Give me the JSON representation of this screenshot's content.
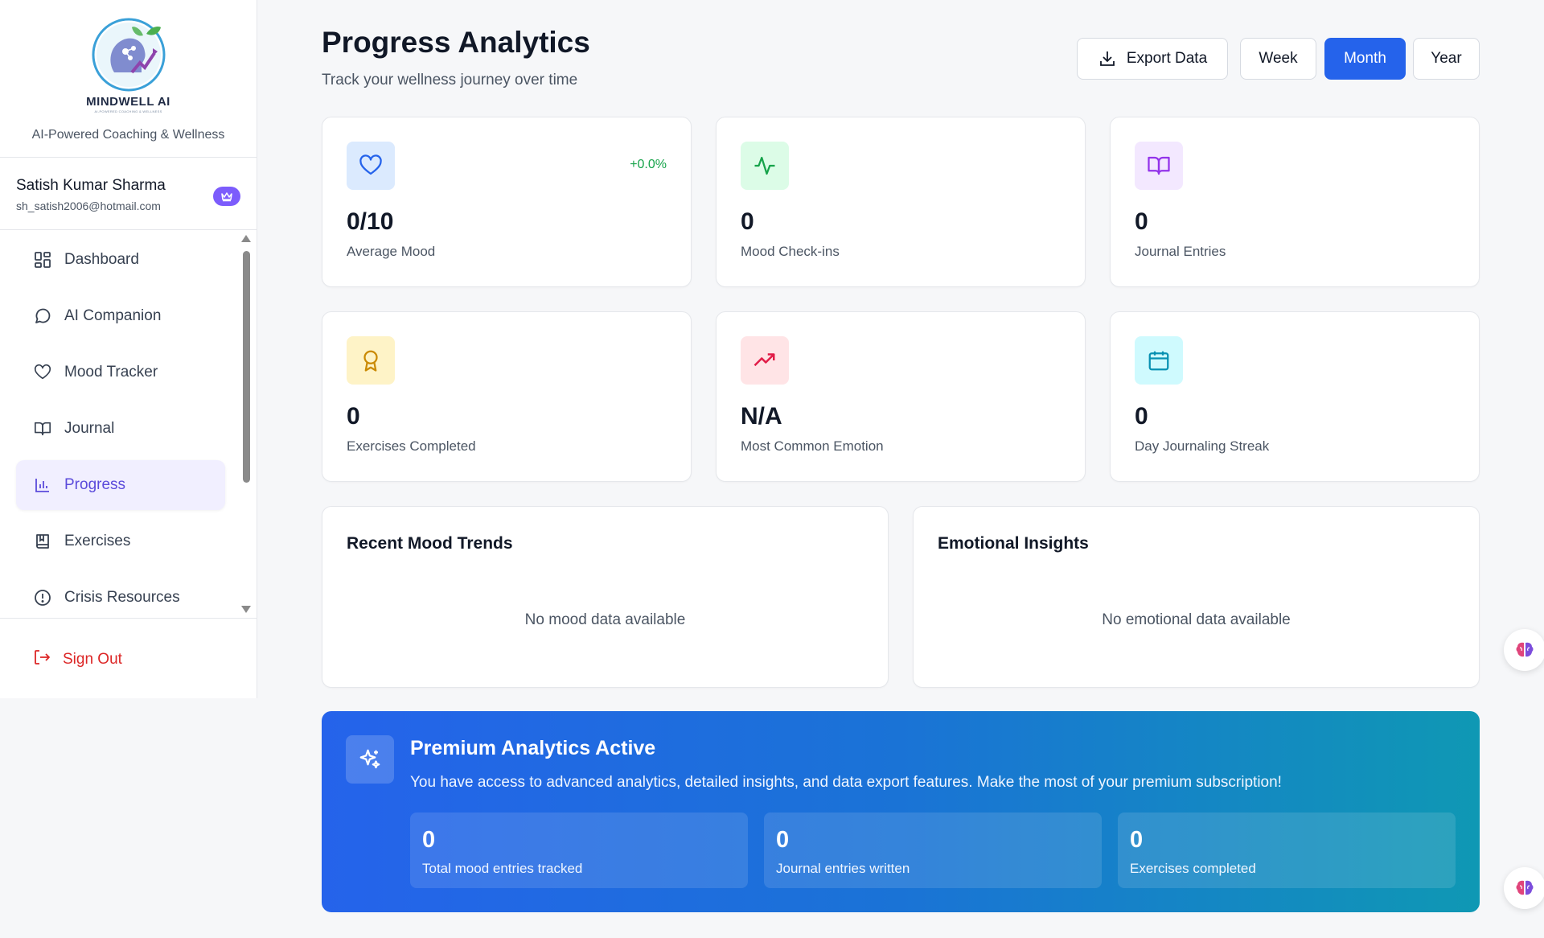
{
  "brand": {
    "logo_name": "MINDWELL AI",
    "logo_tagline": "AI-POWERED COACHING & WELLNESS",
    "subtitle": "AI-Powered Coaching & Wellness"
  },
  "user": {
    "name": "Satish Kumar Sharma",
    "email": "sh_satish2006@hotmail.com",
    "badge_icon": "crown-icon"
  },
  "nav": {
    "items": [
      {
        "label": "Dashboard",
        "icon": "dashboard-grid-icon"
      },
      {
        "label": "AI Companion",
        "icon": "chat-bubble-icon"
      },
      {
        "label": "Mood Tracker",
        "icon": "heart-icon"
      },
      {
        "label": "Journal",
        "icon": "book-open-icon"
      },
      {
        "label": "Progress",
        "icon": "bar-chart-icon",
        "active": true
      },
      {
        "label": "Exercises",
        "icon": "bookmark-book-icon"
      },
      {
        "label": "Crisis Resources",
        "icon": "alert-circle-icon"
      }
    ],
    "signout_label": "Sign Out"
  },
  "header": {
    "title": "Progress Analytics",
    "subtitle": "Track your wellness journey over time",
    "export_label": "Export Data",
    "periods": [
      "Week",
      "Month",
      "Year"
    ],
    "selected_period": "Month"
  },
  "stats": [
    {
      "value": "0/10",
      "label": "Average Mood",
      "change": "+0.0%",
      "icon": "heart-icon",
      "color": "#2563eb",
      "bg": "#dbeafe"
    },
    {
      "value": "0",
      "label": "Mood Check-ins",
      "icon": "activity-pulse-icon",
      "color": "#16a34a",
      "bg": "#dcfce7"
    },
    {
      "value": "0",
      "label": "Journal Entries",
      "icon": "book-open-icon",
      "color": "#9333ea",
      "bg": "#f3e8ff"
    },
    {
      "value": "0",
      "label": "Exercises Completed",
      "icon": "award-ribbon-icon",
      "color": "#ca8a04",
      "bg": "#fef3c7"
    },
    {
      "value": "N/A",
      "label": "Most Common Emotion",
      "icon": "trending-up-icon",
      "color": "#e11d48",
      "bg": "#ffe4e6"
    },
    {
      "value": "0",
      "label": "Day Journaling Streak",
      "icon": "calendar-icon",
      "color": "#0891b2",
      "bg": "#cffafe"
    }
  ],
  "panels": {
    "mood_trends": {
      "title": "Recent Mood Trends",
      "empty": "No mood data available"
    },
    "insights": {
      "title": "Emotional Insights",
      "empty": "No emotional data available"
    }
  },
  "premium": {
    "title": "Premium Analytics Active",
    "description": "You have access to advanced analytics, detailed insights, and data export features. Make the most of your premium subscription!",
    "icon": "sparkles-icon",
    "boxes": [
      {
        "value": "0",
        "label": "Total mood entries tracked"
      },
      {
        "value": "0",
        "label": "Journal entries written"
      },
      {
        "value": "0",
        "label": "Exercises completed"
      }
    ]
  }
}
